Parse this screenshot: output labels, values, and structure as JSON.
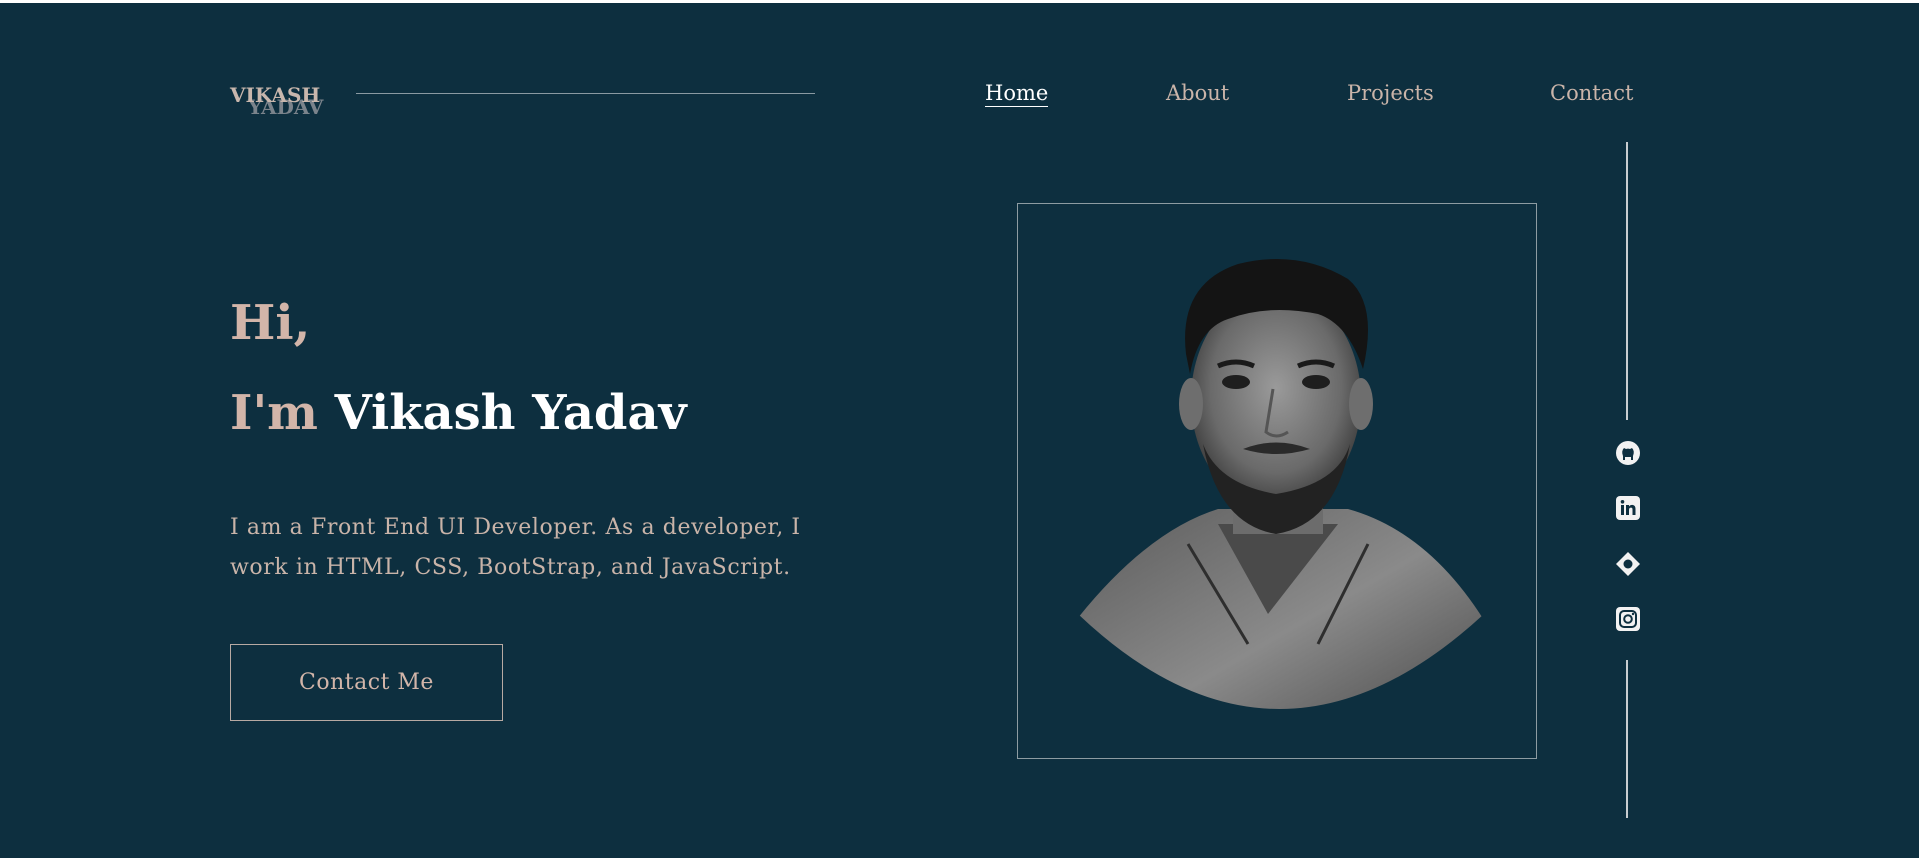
{
  "logo": {
    "first": "VIKASH",
    "last": "YADAV"
  },
  "nav": {
    "items": [
      {
        "label": "Home",
        "active": true
      },
      {
        "label": "About",
        "active": false
      },
      {
        "label": "Projects",
        "active": false
      },
      {
        "label": "Contact",
        "active": false
      }
    ]
  },
  "hero": {
    "greeting": "Hi,",
    "intro_prefix": "I'm ",
    "name": "Vikash Yadav",
    "description": "I am a Front End UI Developer. As a developer, I work in HTML, CSS, BootStrap, and JavaScript.",
    "cta_label": "Contact Me"
  },
  "social": {
    "icons": [
      "github-icon",
      "linkedin-icon",
      "codepen-icon",
      "instagram-icon"
    ]
  },
  "colors": {
    "background": "#0d2f3f",
    "accent": "#d2b5a9",
    "highlight": "#ffffff"
  }
}
